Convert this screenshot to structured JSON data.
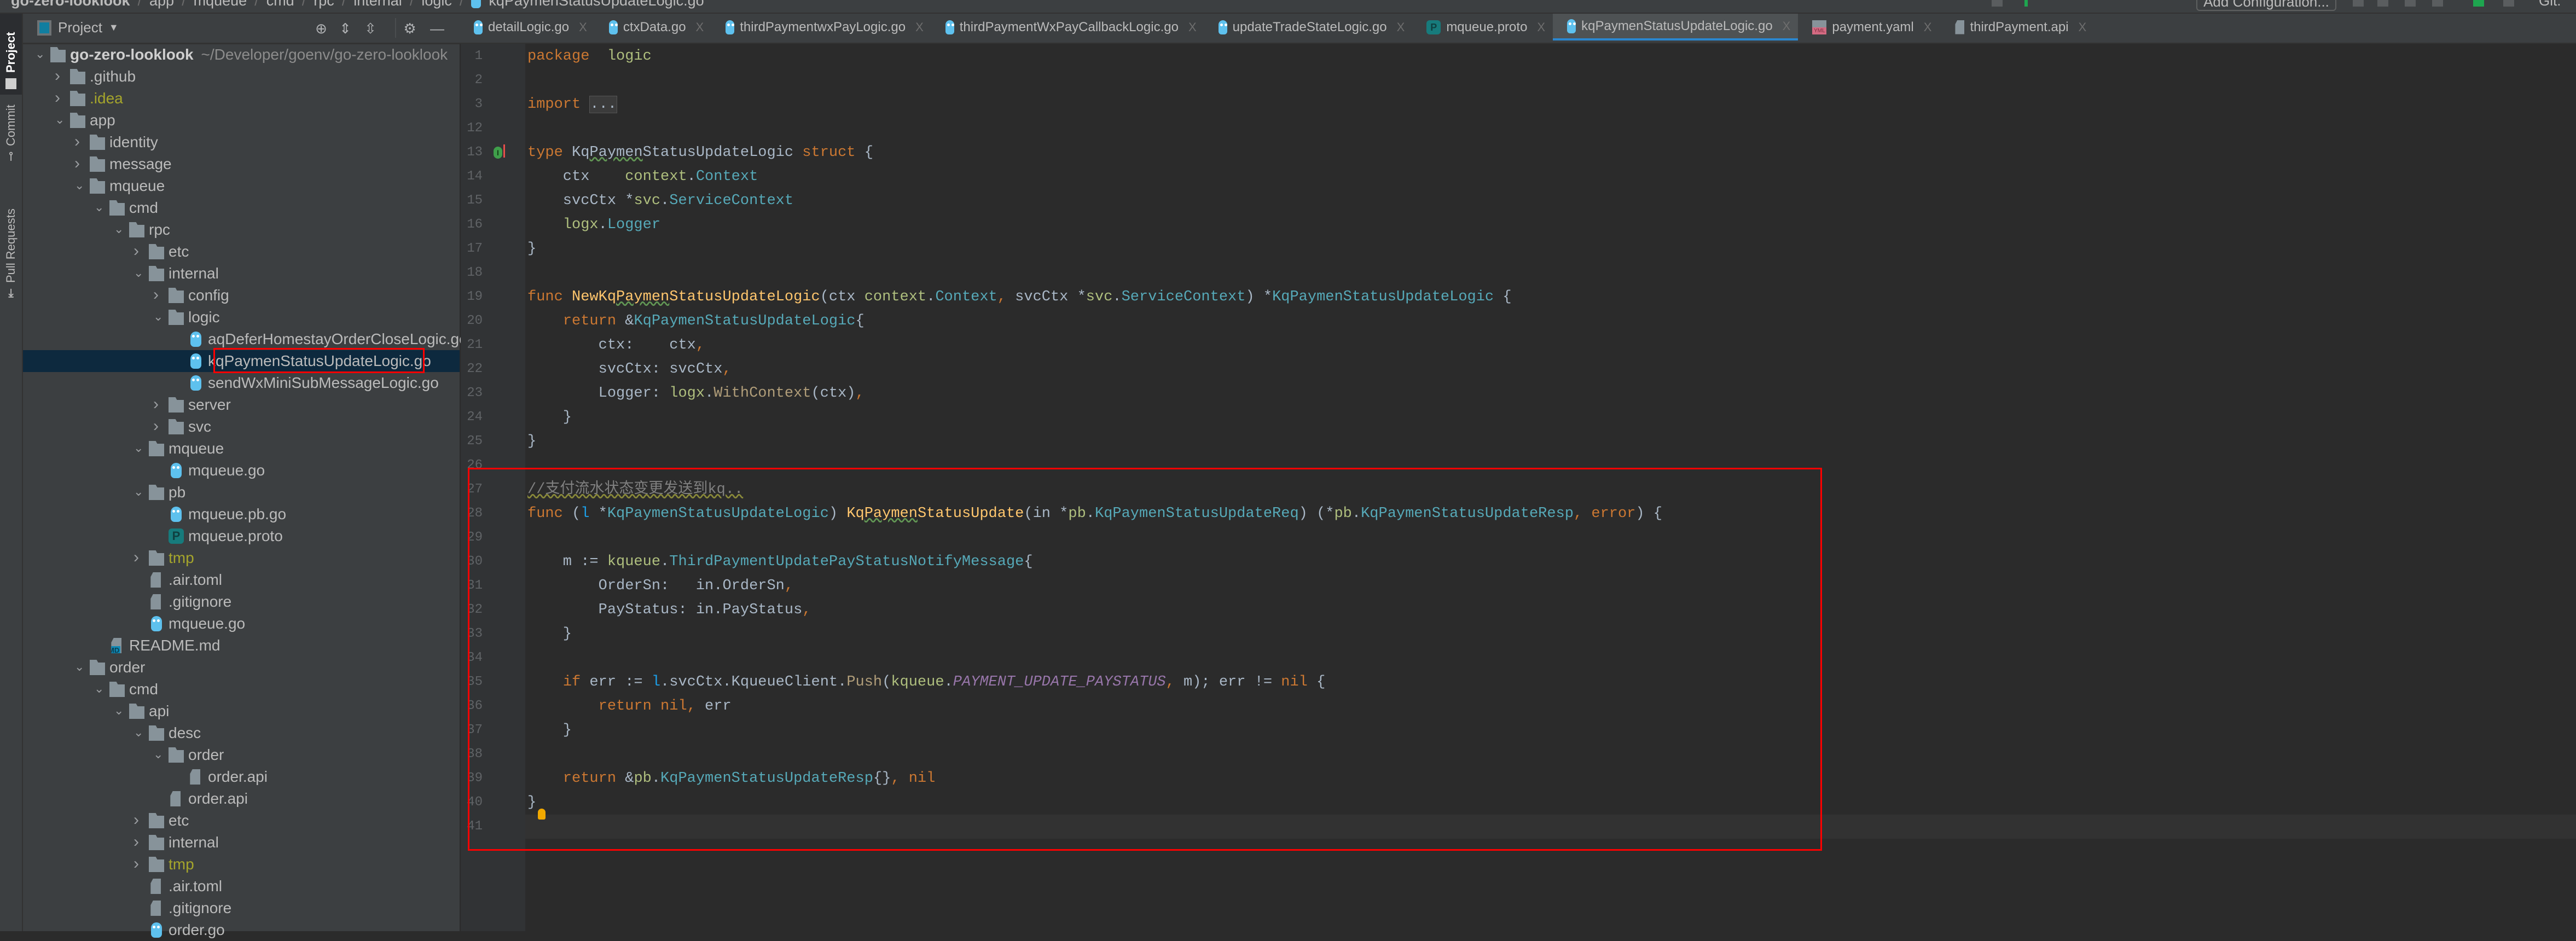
{
  "topbar": {
    "breadcrumb": [
      "go-zero-looklook",
      "app",
      "mqueue",
      "cmd",
      "rpc",
      "internal",
      "logic",
      "kqPaymenStatusUpdateLogic.go"
    ],
    "run_config_label": "Add Configuration...",
    "git_label": "Git:"
  },
  "left_strip": {
    "tabs": [
      {
        "label": "Project",
        "active": true
      },
      {
        "label": "Commit",
        "active": false
      },
      {
        "label": "Pull Requests",
        "active": false
      }
    ]
  },
  "sidebar": {
    "title": "Project",
    "tools": [
      "locate-icon",
      "expand-all-icon",
      "collapse-all-icon",
      "gear-icon",
      "minimize-icon"
    ],
    "root": {
      "name": "go-zero-looklook",
      "path": "~/Developer/goenv/go-zero-looklook"
    },
    "tree": [
      {
        "name": ".github",
        "depth": 1,
        "kind": "folder",
        "expanded": false
      },
      {
        "name": ".idea",
        "depth": 1,
        "kind": "folder",
        "expanded": false,
        "status": "ignored"
      },
      {
        "name": "app",
        "depth": 1,
        "kind": "folder",
        "expanded": true
      },
      {
        "name": "identity",
        "depth": 2,
        "kind": "folder",
        "expanded": false
      },
      {
        "name": "message",
        "depth": 2,
        "kind": "folder",
        "expanded": false
      },
      {
        "name": "mqueue",
        "depth": 2,
        "kind": "folder",
        "expanded": true
      },
      {
        "name": "cmd",
        "depth": 3,
        "kind": "folder",
        "expanded": true
      },
      {
        "name": "rpc",
        "depth": 4,
        "kind": "folder",
        "expanded": true
      },
      {
        "name": "etc",
        "depth": 5,
        "kind": "folder",
        "expanded": false
      },
      {
        "name": "internal",
        "depth": 5,
        "kind": "folder",
        "expanded": true
      },
      {
        "name": "config",
        "depth": 6,
        "kind": "folder",
        "expanded": false
      },
      {
        "name": "logic",
        "depth": 6,
        "kind": "folder",
        "expanded": true
      },
      {
        "name": "aqDeferHomestayOrderCloseLogic.go",
        "depth": 7,
        "kind": "go"
      },
      {
        "name": "kqPaymenStatusUpdateLogic.go",
        "depth": 7,
        "kind": "go",
        "selected": true
      },
      {
        "name": "sendWxMiniSubMessageLogic.go",
        "depth": 7,
        "kind": "go"
      },
      {
        "name": "server",
        "depth": 6,
        "kind": "folder",
        "expanded": false
      },
      {
        "name": "svc",
        "depth": 6,
        "kind": "folder",
        "expanded": false
      },
      {
        "name": "mqueue",
        "depth": 5,
        "kind": "folder",
        "expanded": true
      },
      {
        "name": "mqueue.go",
        "depth": 6,
        "kind": "go"
      },
      {
        "name": "pb",
        "depth": 5,
        "kind": "folder",
        "expanded": true
      },
      {
        "name": "mqueue.pb.go",
        "depth": 6,
        "kind": "go"
      },
      {
        "name": "mqueue.proto",
        "depth": 6,
        "kind": "proto"
      },
      {
        "name": "tmp",
        "depth": 5,
        "kind": "folder",
        "expanded": false,
        "status": "ignored"
      },
      {
        "name": ".air.toml",
        "depth": 5,
        "kind": "doc"
      },
      {
        "name": ".gitignore",
        "depth": 5,
        "kind": "doc"
      },
      {
        "name": "mqueue.go",
        "depth": 5,
        "kind": "go"
      },
      {
        "name": "README.md",
        "depth": 3,
        "kind": "md"
      },
      {
        "name": "order",
        "depth": 2,
        "kind": "folder",
        "expanded": true
      },
      {
        "name": "cmd",
        "depth": 3,
        "kind": "folder",
        "expanded": true
      },
      {
        "name": "api",
        "depth": 4,
        "kind": "folder",
        "expanded": true
      },
      {
        "name": "desc",
        "depth": 5,
        "kind": "folder",
        "expanded": true
      },
      {
        "name": "order",
        "depth": 6,
        "kind": "folder",
        "expanded": true
      },
      {
        "name": "order.api",
        "depth": 7,
        "kind": "doc"
      },
      {
        "name": "order.api",
        "depth": 6,
        "kind": "doc"
      },
      {
        "name": "etc",
        "depth": 5,
        "kind": "folder",
        "expanded": false
      },
      {
        "name": "internal",
        "depth": 5,
        "kind": "folder",
        "expanded": false
      },
      {
        "name": "tmp",
        "depth": 5,
        "kind": "folder",
        "expanded": false,
        "status": "ignored"
      },
      {
        "name": ".air.toml",
        "depth": 5,
        "kind": "doc"
      },
      {
        "name": ".gitignore",
        "depth": 5,
        "kind": "doc"
      },
      {
        "name": "order.go",
        "depth": 5,
        "kind": "go"
      }
    ]
  },
  "tabs": [
    {
      "label": "detailLogic.go",
      "icon": "gopher",
      "active": false
    },
    {
      "label": "ctxData.go",
      "icon": "gopher",
      "active": false
    },
    {
      "label": "thirdPaymentwxPayLogic.go",
      "icon": "gopher",
      "active": false
    },
    {
      "label": "thirdPaymentWxPayCallbackLogic.go",
      "icon": "gopher",
      "active": false
    },
    {
      "label": "updateTradeStateLogic.go",
      "icon": "gopher",
      "active": false
    },
    {
      "label": "mqueue.proto",
      "icon": "proto",
      "active": false
    },
    {
      "label": "kqPaymenStatusUpdateLogic.go",
      "icon": "gopher",
      "active": true
    },
    {
      "label": "payment.yaml",
      "icon": "yaml",
      "active": false
    },
    {
      "label": "thirdPayment.api",
      "icon": "doc",
      "active": false
    }
  ],
  "tab_close_glyph": "X",
  "proto_glyph": "P",
  "editor": {
    "current_line": 41,
    "lines": [
      {
        "n": 1,
        "t": [
          [
            "kw",
            "package"
          ],
          [
            "",
            "  "
          ],
          [
            "pkg",
            "logic"
          ]
        ]
      },
      {
        "n": 2,
        "t": []
      },
      {
        "n": 3,
        "t": [
          [
            "kw",
            "import"
          ],
          [
            "",
            " "
          ],
          [
            "fold",
            "..."
          ]
        ]
      },
      {
        "n": 12,
        "t": []
      },
      {
        "n": 13,
        "t": [
          [
            "kw",
            "type"
          ],
          [
            "",
            " Kq"
          ],
          [
            "warn",
            "Paymen"
          ],
          [
            "",
            "StatusUpdateLogic "
          ],
          [
            "kw",
            "struct"
          ],
          [
            "",
            " {"
          ]
        ]
      },
      {
        "n": 14,
        "t": [
          [
            "",
            "    ctx    "
          ],
          [
            "pkg",
            "context"
          ],
          [
            "",
            "."
          ],
          [
            "type",
            "Context"
          ]
        ]
      },
      {
        "n": 15,
        "t": [
          [
            "",
            "    svcCtx *"
          ],
          [
            "pkg",
            "svc"
          ],
          [
            "",
            "."
          ],
          [
            "type",
            "ServiceContext"
          ]
        ]
      },
      {
        "n": 16,
        "t": [
          [
            "",
            "    "
          ],
          [
            "pkg",
            "logx"
          ],
          [
            "",
            "."
          ],
          [
            "type",
            "Logger"
          ]
        ]
      },
      {
        "n": 17,
        "t": [
          [
            "",
            "}"
          ]
        ]
      },
      {
        "n": 18,
        "t": []
      },
      {
        "n": 19,
        "t": [
          [
            "kw",
            "func"
          ],
          [
            "",
            " "
          ],
          [
            "fn",
            "NewKq"
          ],
          [
            "fn warn",
            "Paymen"
          ],
          [
            "fn",
            "StatusUpdateLogic"
          ],
          [
            "",
            "(ctx "
          ],
          [
            "pkg",
            "context"
          ],
          [
            "",
            "."
          ],
          [
            "type",
            "Context"
          ],
          [
            "kw",
            ","
          ],
          [
            "",
            " svcCtx *"
          ],
          [
            "pkg",
            "svc"
          ],
          [
            "",
            "."
          ],
          [
            "type",
            "ServiceContext"
          ],
          [
            "",
            ") *"
          ],
          [
            "type",
            "KqPaymenStatusUpdateLogic"
          ],
          [
            "",
            " {"
          ]
        ]
      },
      {
        "n": 20,
        "t": [
          [
            "",
            "    "
          ],
          [
            "kw",
            "return"
          ],
          [
            "",
            " &"
          ],
          [
            "type",
            "KqPaymenStatusUpdateLogic"
          ],
          [
            "",
            "{"
          ]
        ]
      },
      {
        "n": 21,
        "t": [
          [
            "",
            "        ctx:    ctx"
          ],
          [
            "kw",
            ","
          ]
        ]
      },
      {
        "n": 22,
        "t": [
          [
            "",
            "        svcCtx: svcCtx"
          ],
          [
            "kw",
            ","
          ]
        ]
      },
      {
        "n": 23,
        "t": [
          [
            "",
            "        Logger: "
          ],
          [
            "pkg",
            "logx"
          ],
          [
            "",
            "."
          ],
          [
            "call",
            "WithContext"
          ],
          [
            "",
            "(ctx)"
          ],
          [
            "kw",
            ","
          ]
        ]
      },
      {
        "n": 24,
        "t": [
          [
            "",
            "    }"
          ]
        ]
      },
      {
        "n": 25,
        "t": [
          [
            "",
            "}"
          ]
        ]
      },
      {
        "n": 26,
        "t": []
      },
      {
        "n": 27,
        "t": [
          [
            "cmt",
            "//支付流水状态变更发送到kq.."
          ]
        ]
      },
      {
        "n": 28,
        "t": [
          [
            "kw",
            "func"
          ],
          [
            "",
            " ("
          ],
          [
            "recv",
            "l"
          ],
          [
            "",
            " *"
          ],
          [
            "type",
            "KqPaymenStatusUpdateLogic"
          ],
          [
            "",
            ") "
          ],
          [
            "fn",
            "Kq"
          ],
          [
            "fn warn",
            "Paymen"
          ],
          [
            "fn",
            "StatusUpdate"
          ],
          [
            "",
            "(in *"
          ],
          [
            "pkg",
            "pb"
          ],
          [
            "",
            "."
          ],
          [
            "type",
            "KqPaymenStatusUpdateReq"
          ],
          [
            "",
            ") (*"
          ],
          [
            "pkg",
            "pb"
          ],
          [
            "",
            "."
          ],
          [
            "type",
            "KqPaymenStatusUpdateResp"
          ],
          [
            "kw",
            ","
          ],
          [
            "",
            " "
          ],
          [
            "kw",
            "error"
          ],
          [
            "",
            ") {"
          ]
        ]
      },
      {
        "n": 29,
        "t": []
      },
      {
        "n": 30,
        "t": [
          [
            "",
            "    m := "
          ],
          [
            "pkg",
            "kqueue"
          ],
          [
            "",
            "."
          ],
          [
            "type",
            "ThirdPaymentUpdatePayStatusNotifyMessage"
          ],
          [
            "",
            "{"
          ]
        ]
      },
      {
        "n": 31,
        "t": [
          [
            "",
            "        OrderSn:   in.OrderSn"
          ],
          [
            "kw",
            ","
          ]
        ]
      },
      {
        "n": 32,
        "t": [
          [
            "",
            "        PayStatus: in.PayStatus"
          ],
          [
            "kw",
            ","
          ]
        ]
      },
      {
        "n": 33,
        "t": [
          [
            "",
            "    }"
          ]
        ]
      },
      {
        "n": 34,
        "t": []
      },
      {
        "n": 35,
        "t": [
          [
            "",
            "    "
          ],
          [
            "kw",
            "if"
          ],
          [
            "",
            " err := "
          ],
          [
            "recv",
            "l"
          ],
          [
            "",
            ".svcCtx.KqueueClient."
          ],
          [
            "call",
            "Push"
          ],
          [
            "",
            "("
          ],
          [
            "pkg",
            "kqueue"
          ],
          [
            "",
            "."
          ],
          [
            "const",
            "PAYMENT_UPDATE_PAYSTATUS"
          ],
          [
            "kw",
            ","
          ],
          [
            "",
            " m); err != "
          ],
          [
            "kw",
            "nil"
          ],
          [
            "",
            " {"
          ]
        ]
      },
      {
        "n": 36,
        "t": [
          [
            "",
            "        "
          ],
          [
            "kw",
            "return nil"
          ],
          [
            "kw",
            ","
          ],
          [
            "",
            " err"
          ]
        ]
      },
      {
        "n": 37,
        "t": [
          [
            "",
            "    }"
          ]
        ]
      },
      {
        "n": 38,
        "t": []
      },
      {
        "n": 39,
        "t": [
          [
            "",
            "    "
          ],
          [
            "kw",
            "return"
          ],
          [
            "",
            " &"
          ],
          [
            "pkg",
            "pb"
          ],
          [
            "",
            "."
          ],
          [
            "type",
            "KqPaymenStatusUpdateResp"
          ],
          [
            "",
            "{}"
          ],
          [
            "kw",
            ","
          ],
          [
            "",
            " "
          ],
          [
            "kw",
            "nil"
          ]
        ]
      },
      {
        "n": 40,
        "t": [
          [
            "",
            "}"
          ]
        ]
      },
      {
        "n": 41,
        "t": []
      }
    ]
  },
  "colors": {
    "accent": "#2a87d0",
    "annotation": "#ff0000",
    "selection": "#0d293e"
  }
}
